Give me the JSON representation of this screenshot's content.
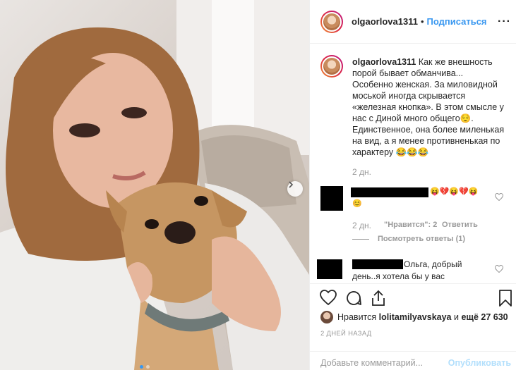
{
  "header": {
    "username": "olgaorlova1311",
    "separator": "•",
    "follow_label": "Подписаться",
    "more_label": "···"
  },
  "caption": {
    "username": "olgaorlova1311",
    "lines": [
      "Как же внешность",
      "порой бывает обманчива...",
      "Особенно женская. За миловидной",
      "моськой иногда скрывается",
      "«железная кнопка». В этом смысле у",
      "нас с Диной много общего😌.",
      "Единственное, она более миленькая",
      "на вид, а я менее противненькая по",
      "характеру 😂😂😂"
    ],
    "time": "2 дн."
  },
  "comment1": {
    "emoji_line": "😝💔😝💔😝",
    "emoji_line2": "😊",
    "time": "2 дн.",
    "likes": "\"Нравится\": 2",
    "reply": "Ответить",
    "view_replies": "Посмотреть ответы (1)"
  },
  "comment2": {
    "text_line1": "Ольга, добрый",
    "text_line2": "день..я хотела бы у вас"
  },
  "likes": {
    "prefix": "Нравится",
    "user": "lolitamilyavskaya",
    "and_more": "и",
    "count_text": "ещё 27 630"
  },
  "timestamp": "2 ДНЕЙ НАЗАД",
  "add_comment": {
    "placeholder": "Добавьте комментарий...",
    "publish_label": "Опубликовать"
  },
  "icons": [
    "heart-icon",
    "comment-icon",
    "share-icon",
    "bookmark-icon",
    "more-icon",
    "next-arrow-icon"
  ],
  "colors": {
    "link": "#3897f0",
    "publish_disabled": "#b2dffc",
    "muted": "#999999"
  }
}
